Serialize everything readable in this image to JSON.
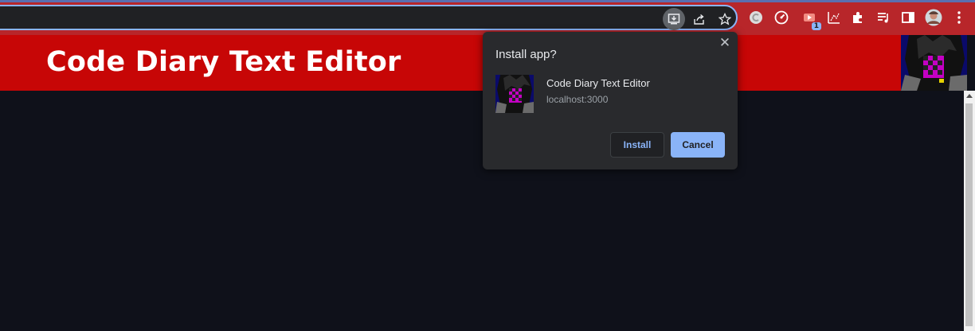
{
  "toolbar": {
    "icons": [
      "install-app-icon",
      "share-icon",
      "bookmark-star-icon",
      "extension-c-icon",
      "speedometer-icon",
      "extension-badge-icon",
      "extension-grid-icon",
      "extensions-puzzle-icon",
      "reading-list-icon",
      "side-panel-icon",
      "profile-avatar",
      "kebab-menu-icon"
    ],
    "badge_count": "1"
  },
  "app": {
    "title": "Code Diary Text Editor"
  },
  "dialog": {
    "title": "Install app?",
    "close_glyph": "✕",
    "app_name": "Code Diary Text Editor",
    "origin": "localhost:3000",
    "install_label": "Install",
    "cancel_label": "Cancel"
  },
  "colors": {
    "toolbar": "#b8262a",
    "header": "#c70606",
    "page_bg": "#0f111a",
    "dialog_bg": "#292a2d",
    "accent": "#8ab4f8"
  }
}
